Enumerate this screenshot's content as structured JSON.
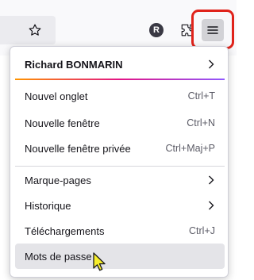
{
  "toolbar": {
    "avatar_letter": "R",
    "icons": [
      "star-icon",
      "extensions-icon",
      "hamburger-menu-icon"
    ]
  },
  "menu": {
    "account": {
      "label": "Richard BONMARIN"
    },
    "items": [
      {
        "label": "Nouvel onglet",
        "shortcut": "Ctrl+T"
      },
      {
        "label": "Nouvelle fenêtre",
        "shortcut": "Ctrl+N"
      },
      {
        "label": "Nouvelle fenêtre privée",
        "shortcut": "Ctrl+Maj+P"
      },
      {
        "label": "Marque-pages",
        "shortcut": ""
      },
      {
        "label": "Historique",
        "shortcut": ""
      },
      {
        "label": "Téléchargements",
        "shortcut": "Ctrl+J"
      },
      {
        "label": "Mots de passe",
        "shortcut": ""
      }
    ]
  },
  "colors": {
    "highlight_ring": "#e0231b",
    "hover_row": "#e4e4e8",
    "account_gradient": [
      "#ff9500",
      "#e31587",
      "#9059ff"
    ]
  }
}
